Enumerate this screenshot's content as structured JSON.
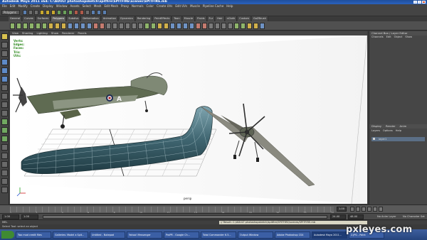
{
  "window": {
    "title": "Autodesk Maya 2011 x64: C:\\ADULT photoshopsketch\\spitfire\\SPITFIRE\\scenes\\SPITFIRE.mb"
  },
  "menu": [
    "File",
    "Edit",
    "Modify",
    "Create",
    "Display",
    "Window",
    "Assets",
    "Select",
    "Mesh",
    "Edit Mesh",
    "Proxy",
    "Normals",
    "Color",
    "Create UVs",
    "Edit UVs",
    "Muscle",
    "Pipeline Cache",
    "Help"
  ],
  "status": {
    "mode": "Polygons"
  },
  "shelf_tabs": [
    "General",
    "Curves",
    "Surfaces",
    "Polygons",
    "Subdivs",
    "Deformation",
    "Animation",
    "Dynamics",
    "Rendering",
    "PaintEffects",
    "Toon",
    "Muscle",
    "Fluids",
    "Fur",
    "Hair",
    "nCloth",
    "Custom",
    "GoZBrush"
  ],
  "shelf_active": "Polygons",
  "panel_menu": [
    "View",
    "Shading",
    "Lighting",
    "Show",
    "Renderer",
    "Panels"
  ],
  "hud": [
    "Verts:",
    "Edges:",
    "Faces:",
    "Tris:",
    "UVs:"
  ],
  "viewport": {
    "camera_label": "persp"
  },
  "channel_box": {
    "title": "Channel Box / Layer Editor",
    "menu": [
      "Channels",
      "Edit",
      "Object",
      "Show"
    ]
  },
  "layer_editor": {
    "tabs": [
      "Display",
      "Render",
      "Anim"
    ],
    "options": [
      "Layers",
      "Options",
      "Help"
    ],
    "layers": [
      "layer1"
    ]
  },
  "timeline": {
    "ticks": [
      "1",
      "2",
      "4",
      "6",
      "8",
      "10",
      "12",
      "14",
      "16",
      "18",
      "20",
      "22",
      "24"
    ],
    "current_frame": "1.00"
  },
  "range": {
    "start": "1.00",
    "inner_start": "1.00",
    "end": "24.00",
    "outer_end": "48.00",
    "anim_layer": "No Anim Layer",
    "char_set": "No Character Set"
  },
  "command": {
    "label": "MEL",
    "result": "// Result: C:/ADULT photoshopsketch/spitfire/SPITFIRE/scenes/SPITFIRE.mb"
  },
  "help_line": "Select Tool: select an object",
  "taskbar": [
    "Two mod credit files",
    "Galleries: Model a Spit...",
    "Untitled - Notepad",
    "Yahoo! Messenger",
    "ProPR - Google Ch...",
    "Total Commander 6.5...",
    "Output Window",
    "Adobe Photoshop CS4",
    "Autodesk Maya 2011...",
    "2.JPG - Paint"
  ],
  "taskbar_active": "Autodesk Maya 2011...",
  "watermark": "pxleyes.com",
  "spitfire_marking": "A"
}
